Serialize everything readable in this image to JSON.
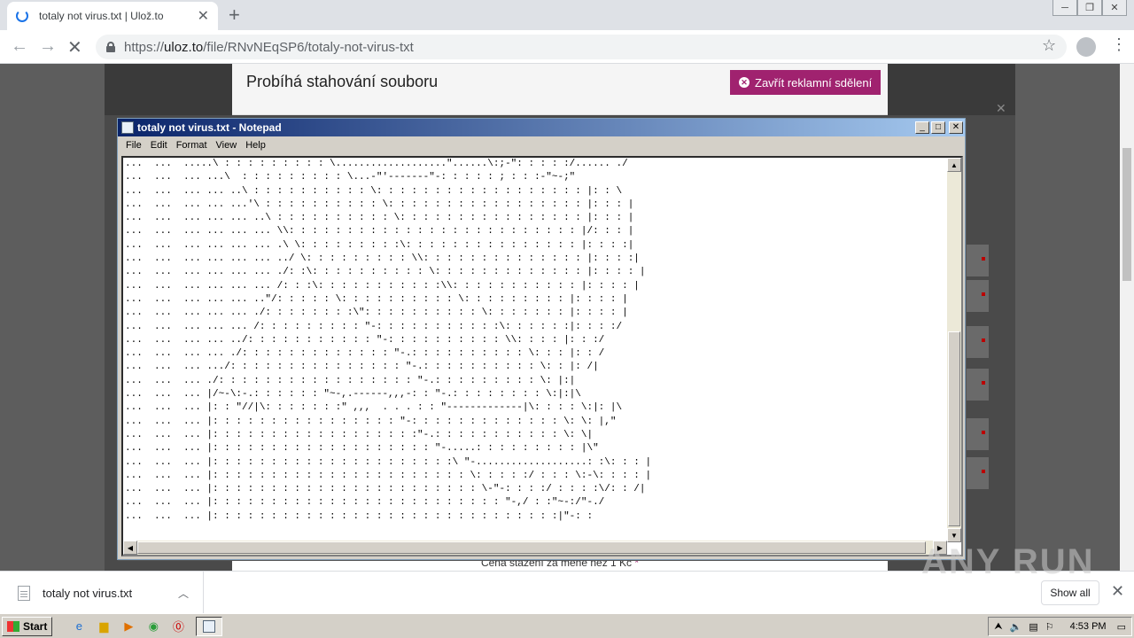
{
  "browser": {
    "tab_title": "totaly not virus.txt | Ulož.to",
    "new_tab": "+",
    "url_scheme": "https://",
    "url_host": "uloz.to",
    "url_path": "/file/RNvNEqSP6/totaly-not-virus-txt"
  },
  "ad": {
    "title": "Probíhá stahování souboru",
    "close_label": "Zavřít reklamní sdělení",
    "footer_text": "Cena stažení za méně než 1 Kč",
    "footer_link": "*"
  },
  "notepad": {
    "title": "totaly not virus.txt - Notepad",
    "menus": [
      "File",
      "Edit",
      "Format",
      "View",
      "Help"
    ],
    "content": "...  ...  .....\\ : : : : : : : : : \\...................\"......\\:;-\": : : : :/...... ./\n...  ...  ... ...\\  : : : : : : : : : \\...-\"'-------\"-: : : : : ; : : :-\"~-;\"\n...  ...  ... ... ..\\ : : : : : : : : : : \\: : : : : : : : : : : : : : : : : : |: : \\\n...  ...  ... ... ...'\\ : : : : : : : : : : \\: : : : : : : : : : : : : : : : : |: : : |\n...  ...  ... ... ... ..\\ : : : : : : : : : : \\: : : : : : : : : : : : : : : : |: : : |\n...  ...  ... ... ... ... \\\\: : : : : : : : : : : : : : : : : : : : : : : : : |/: : : |\n...  ...  ... ... ... ... .\\ \\: : : : : : : : :\\: : : : : : : : : : : : : : : |: : : :|\n...  ...  ... ... ... ... ../ \\: : : : : : : : : \\\\: : : : : : : : : : : : : : |: : : :|\n...  ...  ... ... ... ... ./: :\\: : : : : : : : : : \\: : : : : : : : : : : : : |: : : : |\n...  ...  ... ... ... ... /: : :\\: : : : : : : : : : :\\\\: : : : : : : : : : : |: : : : |\n...  ...  ... ... ... ..\"/: : : : : \\: : : : : : : : : : \\: : : : : : : : : |: : : : |\n...  ...  ... ... ... ./: : : : : : : :\\\": : : : : : : : : : \\: : : : : : : |: : : : |\n...  ...  ... ... ... /: : : : : : : : : \"-: : : : : : : : : : :\\: : : : : :|: : : :/\n...  ...  ... ... ../: : : : : : : : : : : \"-: : : : : : : : : : \\\\: : : : |: : :/\n...  ...  ... ... ./: : : : : : : : : : : : : \"-.: : : : : : : : : : \\: : : |: : /\n...  ...  ... .../: : : : : : : : : : : : : : : \"-.: : : : : : : : : : \\: : |: /|\n...  ...  ... ./: : : : : : : : : : : : : : : : : \"-.: : : : : : : : : \\: |:|\n...  ...  ... |/~-\\:-.: : : : : : \"~-,.------,,,-: : \"-.: : : : : : : : \\:|:|\\\n...  ...  ... |: : \"//|\\: : : : : : :\" ,,,  . . . : : \"-------------|\\: : : : \\:|: |\\\n...  ...  ... |: : : : : : : : : : : : : : : : \"-: : : : : : : : : : : : : \\: \\: |,\"\n...  ...  ... |: : : : : : : : : : : : : : : : : :\"-.: : : : : : : : : : : \\: \\|\n...  ...  ... |: : : : : : : : : : : : : : : : : : : \"-.....: : : : : : : : : |\\\"\n...  ...  ... |: : : : : : : : : : : : : : : : : : : : :\\ \"-...................: :\\: : : |\n...  ...  ... |: : : : : : : : : : : : : : : : : : : : : : \\: : : : :/ : : : \\:-\\: : : : |\n...  ...  ... |: : : : : : : : : : : : : : : : : : : : : : : \\-\"-: : : :/ : : : :\\/: : /|\n...  ...  ... |: : : : : : : : : : : : : : : : : : : : : : : : : \"-,/ : :\"~-:/\"-./\n...  ...  ... |: : : : : : : : : : : : : : : : : : : : : : : : : : : : : :|\"-: :"
  },
  "downloads": {
    "file_name": "totaly not virus.txt",
    "show_all": "Show all"
  },
  "watermark": "ANY RUN",
  "taskbar": {
    "start_label": "Start",
    "clock": "4:53 PM"
  }
}
